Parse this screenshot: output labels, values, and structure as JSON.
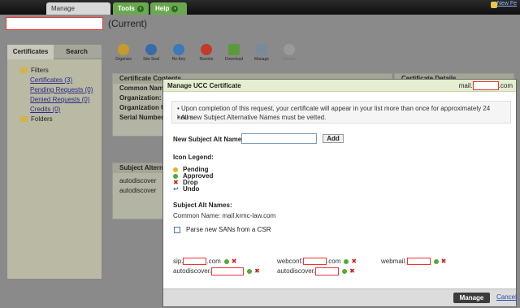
{
  "topbar": {
    "tabs": [
      {
        "label": "Manage Certificates"
      },
      {
        "label": "Tools"
      },
      {
        "label": "Help"
      }
    ],
    "new_features": "New Fe"
  },
  "app": {
    "current_label": "(Current)",
    "left_tabs": [
      "Certificates",
      "Search"
    ],
    "tree": {
      "filters": "Filters",
      "items": [
        "Certificates (3)",
        "Pending Requests (0)",
        "Denied Requests (0)",
        "Credits (0)"
      ],
      "folders": "Folders"
    },
    "toolbar": [
      "Organize",
      "Site Seal",
      "Re-Key",
      "Revoke",
      "Download",
      "Manage",
      "Transfer"
    ],
    "contents": {
      "title": "Certificate Contents",
      "rows": [
        "Common Name",
        "Organization:",
        "Organization Ur",
        "Serial Number:"
      ]
    },
    "subject_alt": {
      "title": "Subject Alternat",
      "rows": [
        "autodiscover",
        "autodiscover"
      ]
    },
    "details_title": "Certificate Details"
  },
  "modal": {
    "title": "Manage UCC Certificate",
    "domain_prefix": "mail.",
    "domain_suffix": ".com",
    "notice": [
      "Upon completion of this request, your certificate will appear in your list more than once for approximately 24 hours.",
      "All new Subject Alternative Names must be vetted."
    ],
    "new_alt_label": "New Subject Alt Name:",
    "add_label": "Add",
    "legend_title": "Icon Legend:",
    "legend": [
      "Pending",
      "Approved",
      "Drop",
      "Undo"
    ],
    "alt_names_title": "Subject Alt Names:",
    "common_name": "Common Name: mail.krmc-law.com",
    "parse_csr": "Parse new SANs from a CSR",
    "sans": [
      {
        "prefix": "sip.",
        "suffix": ".com"
      },
      {
        "prefix": "webconf.",
        "suffix": ".com"
      },
      {
        "prefix": "webmail.",
        "suffix": ""
      },
      {
        "prefix": "autodiscover.",
        "suffix": ""
      },
      {
        "prefix": "autodiscover.",
        "suffix": ""
      }
    ],
    "manage_label": "Manage",
    "cancel_label": "Cancel"
  }
}
